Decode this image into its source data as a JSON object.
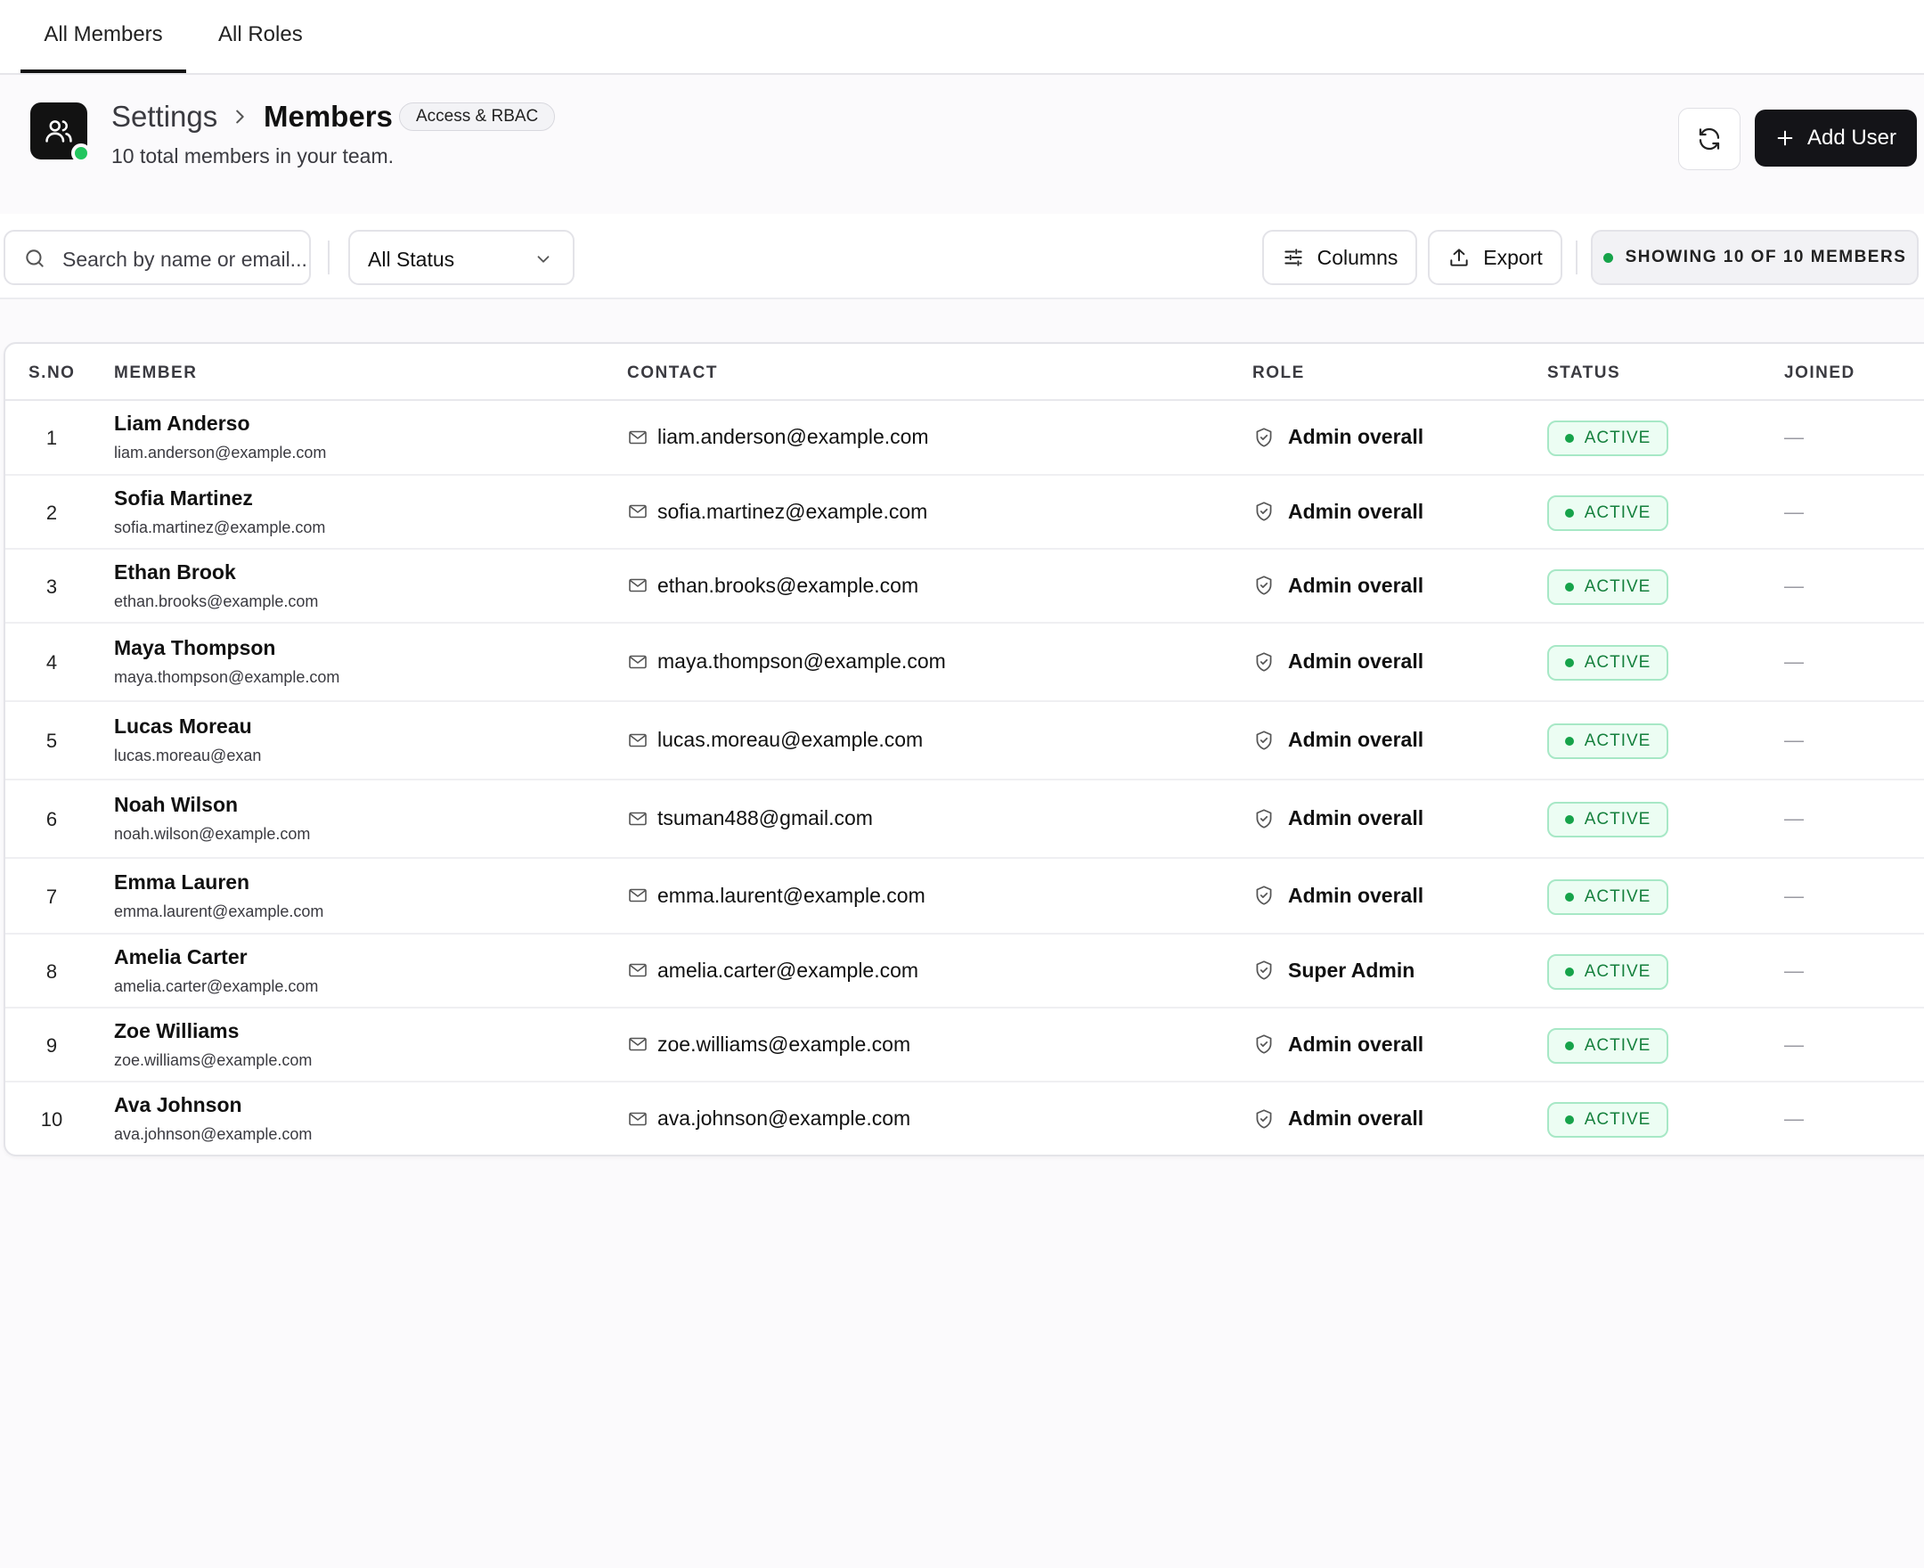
{
  "tabs": [
    {
      "label": "All Members",
      "active": true
    },
    {
      "label": "All Roles",
      "active": false
    }
  ],
  "header": {
    "breadcrumb_parent": "Settings",
    "breadcrumb_current": "Members",
    "badge": "Access & RBAC",
    "subtitle": "10 total members in your team.",
    "add_button_label": "Add User",
    "app_icon": "users-icon",
    "online_color": "#22c55e"
  },
  "toolbar": {
    "search_placeholder": "Search by name or email...",
    "status_filter_value": "All Status",
    "columns_label": "Columns",
    "export_label": "Export",
    "showing_text": "SHOWING 10 OF 10 MEMBERS"
  },
  "table": {
    "headers": {
      "sno": "S.NO",
      "member": "MEMBER",
      "contact": "CONTACT",
      "role": "ROLE",
      "status": "STATUS",
      "joined": "JOINED"
    },
    "rows": [
      {
        "sno": "1",
        "name": "Liam Anderso",
        "sub": "liam.anderson@example.com",
        "email": "liam.anderson@example.com",
        "role": "Admin overall",
        "status": "ACTIVE",
        "joined": "—"
      },
      {
        "sno": "2",
        "name": "Sofia Martinez",
        "sub": "sofia.martinez@example.com",
        "email": "sofia.martinez@example.com",
        "role": "Admin overall",
        "status": "ACTIVE",
        "joined": "—"
      },
      {
        "sno": "3",
        "name": "Ethan Brook",
        "sub": "ethan.brooks@example.com",
        "email": "ethan.brooks@example.com",
        "role": "Admin overall",
        "status": "ACTIVE",
        "joined": "—"
      },
      {
        "sno": "4",
        "name": "Maya Thompson",
        "sub": "maya.thompson@example.com",
        "email": "maya.thompson@example.com",
        "role": "Admin overall",
        "status": "ACTIVE",
        "joined": "—"
      },
      {
        "sno": "5",
        "name": "Lucas Moreau",
        "sub": "lucas.moreau@exan",
        "email": "lucas.moreau@example.com",
        "role": "Admin overall",
        "status": "ACTIVE",
        "joined": "—"
      },
      {
        "sno": "6",
        "name": "Noah Wilson",
        "sub": "noah.wilson@example.com",
        "email": "tsuman488@gmail.com",
        "role": "Admin overall",
        "status": "ACTIVE",
        "joined": "—"
      },
      {
        "sno": "7",
        "name": "Emma Lauren",
        "sub": "emma.laurent@example.com",
        "email": "emma.laurent@example.com",
        "role": "Admin overall",
        "status": "ACTIVE",
        "joined": "—"
      },
      {
        "sno": "8",
        "name": "Amelia Carter",
        "sub": "amelia.carter@example.com",
        "email": "amelia.carter@example.com",
        "role": "Super Admin",
        "status": "ACTIVE",
        "joined": "—"
      },
      {
        "sno": "9",
        "name": "Zoe Williams",
        "sub": "zoe.williams@example.com",
        "email": "zoe.williams@example.com",
        "role": "Admin overall",
        "status": "ACTIVE",
        "joined": "—"
      },
      {
        "sno": "10",
        "name": "Ava Johnson",
        "sub": "ava.johnson@example.com",
        "email": "ava.johnson@example.com",
        "role": "Admin overall",
        "status": "ACTIVE",
        "joined": "—"
      }
    ]
  }
}
